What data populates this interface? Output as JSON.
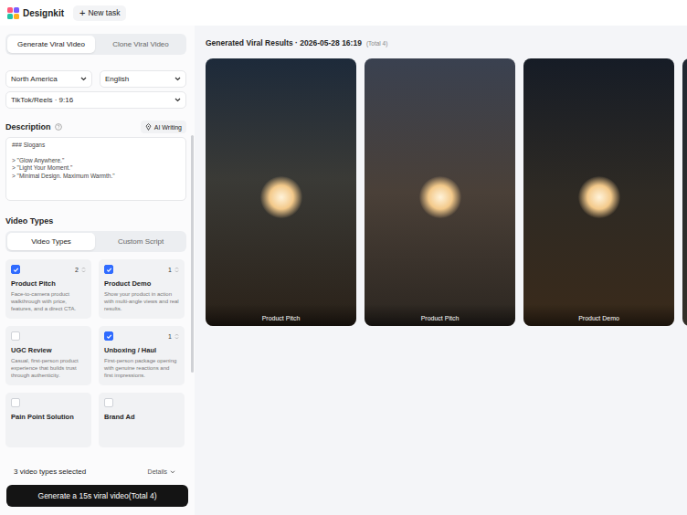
{
  "app": {
    "name": "Designkit"
  },
  "top_bar": {
    "new_task": {
      "icon": "+",
      "label": "New task"
    }
  },
  "mode_tabs": [
    {
      "label": "Generate Viral Video",
      "selected": true
    },
    {
      "label": "Clone Viral Video",
      "selected": false
    }
  ],
  "selects": {
    "region": "North America",
    "language": "English",
    "format": "TikTok/Reels · 9:16"
  },
  "description": {
    "label": "Description",
    "ai_button": "AI Writing",
    "lines": [
      "### Slogans",
      "",
      "> \"Glow Anywhere.\"",
      "> \"Light Your Moment.\"",
      "> \"Minimal Design. Maximum Warmth.\""
    ]
  },
  "video_types": {
    "title": "Video Types",
    "tabs": [
      {
        "label": "Video Types",
        "selected": true
      },
      {
        "label": "Custom Script",
        "selected": false
      }
    ],
    "items": [
      {
        "title": "Product Pitch",
        "desc": "Face-to-camera product walkthrough with price, features, and a direct CTA.",
        "checked": true,
        "count": "2"
      },
      {
        "title": "Product Demo",
        "desc": "Show your product in action with multi-angle views and real results.",
        "checked": true,
        "count": "1"
      },
      {
        "title": "UGC Review",
        "desc": "Casual, first-person product experience that builds trust through authenticity.",
        "checked": false
      },
      {
        "title": "Unboxing / Haul",
        "desc": "First-person package opening with genuine reactions and first impressions.",
        "checked": true,
        "count": "1"
      },
      {
        "title": "Pain Point Solution",
        "checked": false
      },
      {
        "title": "Brand Ad",
        "checked": false
      }
    ]
  },
  "footer": {
    "selected_summary": "3 video types selected",
    "details": "Details",
    "generate_button": "Generate a 15s viral video(Total 4)"
  },
  "results": {
    "title": "Generated Viral Results · 2026-05-28 16:19",
    "total": "(Total 4)",
    "items": [
      {
        "label": "Product Pitch"
      },
      {
        "label": "Product Pitch"
      },
      {
        "label": "Product Demo"
      },
      {}
    ]
  }
}
